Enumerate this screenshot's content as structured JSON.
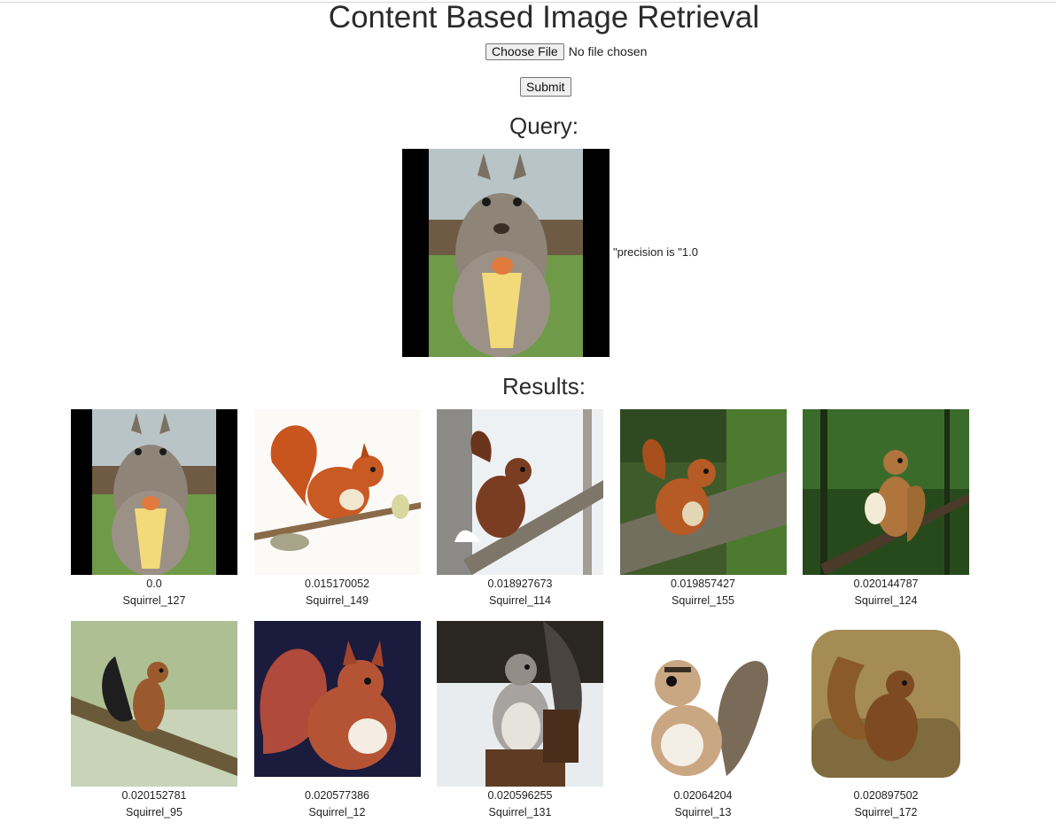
{
  "header": {
    "title": "Content Based Image Retrieval"
  },
  "upload": {
    "choose_file_label": "Choose File",
    "file_status": "No file chosen",
    "submit_label": "Submit"
  },
  "query": {
    "heading": "Query:",
    "precision_text": "\"precision is \"1.0"
  },
  "results": {
    "heading": "Results:",
    "items": [
      {
        "score": "0.0",
        "name": "Squirrel_127"
      },
      {
        "score": "0.015170052",
        "name": "Squirrel_149"
      },
      {
        "score": "0.018927673",
        "name": "Squirrel_114"
      },
      {
        "score": "0.019857427",
        "name": "Squirrel_155"
      },
      {
        "score": "0.020144787",
        "name": "Squirrel_124"
      },
      {
        "score": "0.020152781",
        "name": "Squirrel_95"
      },
      {
        "score": "0.020577386",
        "name": "Squirrel_12"
      },
      {
        "score": "0.020596255",
        "name": "Squirrel_131"
      },
      {
        "score": "0.02064204",
        "name": "Squirrel_13"
      },
      {
        "score": "0.020897502",
        "name": "Squirrel_172"
      }
    ]
  },
  "colors": {
    "text": "#333333",
    "rule": "#d6d6d6",
    "button_bg": "#efefef",
    "button_border": "#767676"
  }
}
